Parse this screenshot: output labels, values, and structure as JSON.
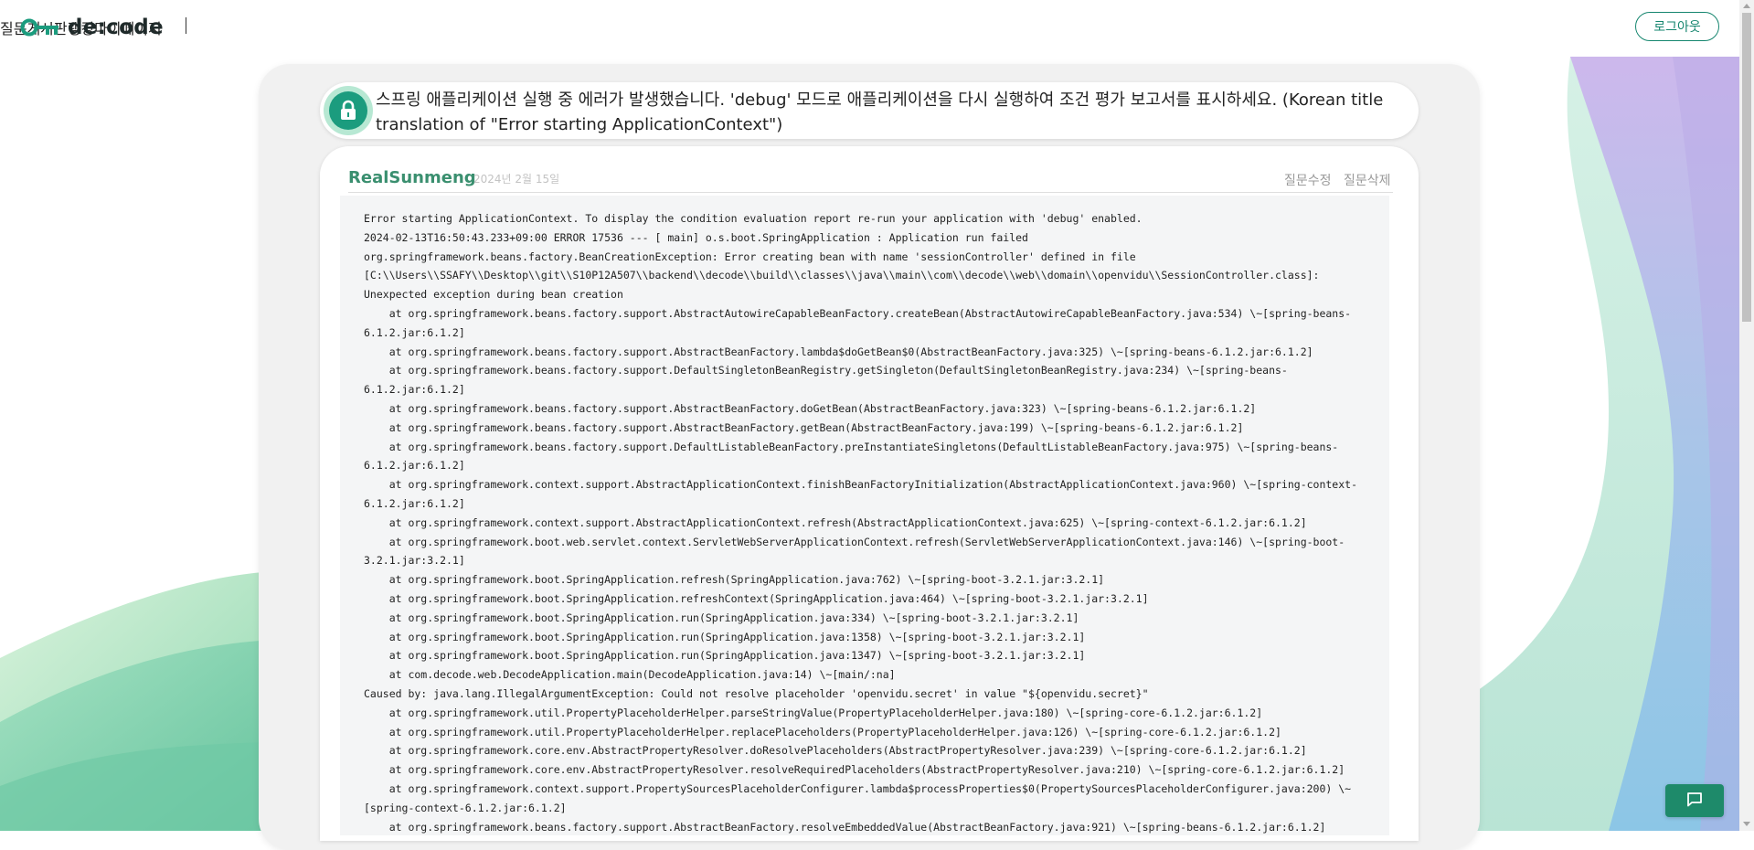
{
  "header": {
    "brand": "de:code",
    "nav": [
      {
        "label": "질문게시판"
      },
      {
        "label": "랭킹"
      },
      {
        "label": "마이페이지"
      }
    ],
    "logout_label": "로그아웃"
  },
  "post": {
    "title": "스프링 애플리케이션 실행 중 에러가 발생했습니다. 'debug' 모드로 애플리케이션을 다시 실행하여 조건 평가 보고서를 표시하세요. (Korean title translation of \"Error starting ApplicationContext\")",
    "author": "RealSunmeng",
    "date": "2024년 2월 15일",
    "edit_label": "질문수정",
    "delete_label": "질문삭제",
    "code_lines": [
      "Error starting ApplicationContext. To display the condition evaluation report re-run your application with 'debug' enabled.",
      "2024-02-13T16:50:43.233+09:00 ERROR 17536 --- [ main] o.s.boot.SpringApplication : Application run failed",
      "org.springframework.beans.factory.BeanCreationException: Error creating bean with name 'sessionController' defined in file",
      "[C:\\\\Users\\\\SSAFY\\\\Desktop\\\\git\\\\S10P12A507\\\\backend\\\\decode\\\\build\\\\classes\\\\java\\\\main\\\\com\\\\decode\\\\web\\\\domain\\\\openvidu\\\\SessionController.class]:",
      "Unexpected exception during bean creation",
      "    at org.springframework.beans.factory.support.AbstractAutowireCapableBeanFactory.createBean(AbstractAutowireCapableBeanFactory.java:534) \\~[spring-beans-",
      "6.1.2.jar:6.1.2]",
      "    at org.springframework.beans.factory.support.AbstractBeanFactory.lambda$doGetBean$0(AbstractBeanFactory.java:325) \\~[spring-beans-6.1.2.jar:6.1.2]",
      "    at org.springframework.beans.factory.support.DefaultSingletonBeanRegistry.getSingleton(DefaultSingletonBeanRegistry.java:234) \\~[spring-beans-",
      "6.1.2.jar:6.1.2]",
      "    at org.springframework.beans.factory.support.AbstractBeanFactory.doGetBean(AbstractBeanFactory.java:323) \\~[spring-beans-6.1.2.jar:6.1.2]",
      "    at org.springframework.beans.factory.support.AbstractBeanFactory.getBean(AbstractBeanFactory.java:199) \\~[spring-beans-6.1.2.jar:6.1.2]",
      "    at org.springframework.beans.factory.support.DefaultListableBeanFactory.preInstantiateSingletons(DefaultListableBeanFactory.java:975) \\~[spring-beans-",
      "6.1.2.jar:6.1.2]",
      "    at org.springframework.context.support.AbstractApplicationContext.finishBeanFactoryInitialization(AbstractApplicationContext.java:960) \\~[spring-context-",
      "6.1.2.jar:6.1.2]",
      "    at org.springframework.context.support.AbstractApplicationContext.refresh(AbstractApplicationContext.java:625) \\~[spring-context-6.1.2.jar:6.1.2]",
      "    at org.springframework.boot.web.servlet.context.ServletWebServerApplicationContext.refresh(ServletWebServerApplicationContext.java:146) \\~[spring-boot-",
      "3.2.1.jar:3.2.1]",
      "    at org.springframework.boot.SpringApplication.refresh(SpringApplication.java:762) \\~[spring-boot-3.2.1.jar:3.2.1]",
      "    at org.springframework.boot.SpringApplication.refreshContext(SpringApplication.java:464) \\~[spring-boot-3.2.1.jar:3.2.1]",
      "    at org.springframework.boot.SpringApplication.run(SpringApplication.java:334) \\~[spring-boot-3.2.1.jar:3.2.1]",
      "    at org.springframework.boot.SpringApplication.run(SpringApplication.java:1358) \\~[spring-boot-3.2.1.jar:3.2.1]",
      "    at org.springframework.boot.SpringApplication.run(SpringApplication.java:1347) \\~[spring-boot-3.2.1.jar:3.2.1]",
      "    at com.decode.web.DecodeApplication.main(DecodeApplication.java:14) \\~[main/:na]",
      "Caused by: java.lang.IllegalArgumentException: Could not resolve placeholder 'openvidu.secret' in value \"${openvidu.secret}\"",
      "    at org.springframework.util.PropertyPlaceholderHelper.parseStringValue(PropertyPlaceholderHelper.java:180) \\~[spring-core-6.1.2.jar:6.1.2]",
      "    at org.springframework.util.PropertyPlaceholderHelper.replacePlaceholders(PropertyPlaceholderHelper.java:126) \\~[spring-core-6.1.2.jar:6.1.2]",
      "    at org.springframework.core.env.AbstractPropertyResolver.doResolvePlaceholders(AbstractPropertyResolver.java:239) \\~[spring-core-6.1.2.jar:6.1.2]",
      "    at org.springframework.core.env.AbstractPropertyResolver.resolveRequiredPlaceholders(AbstractPropertyResolver.java:210) \\~[spring-core-6.1.2.jar:6.1.2]",
      "    at org.springframework.context.support.PropertySourcesPlaceholderConfigurer.lambda$processProperties$0(PropertySourcesPlaceholderConfigurer.java:200) \\~",
      "[spring-context-6.1.2.jar:6.1.2]",
      "    at org.springframework.beans.factory.support.AbstractBeanFactory.resolveEmbeddedValue(AbstractBeanFactory.java:921) \\~[spring-beans-6.1.2.jar:6.1.2]"
    ]
  },
  "colors": {
    "brand_green": "#1b9c7e",
    "author_green": "#3a8f6f",
    "card_bg": "#f1f1f1",
    "code_bg": "#f4f5f6"
  },
  "icons": {
    "logo": "key-icon",
    "title": "lock-icon",
    "chat": "chat-bubble-icon"
  }
}
